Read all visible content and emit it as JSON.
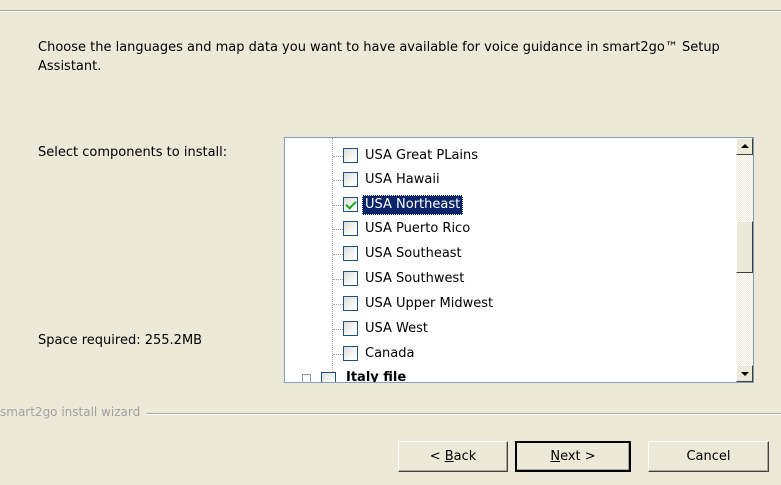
{
  "header": {
    "description": "Choose the languages and map data you want to have available for voice guidance in smart2go™ Setup Assistant."
  },
  "labels": {
    "select_components": "Select components to install:",
    "space_required": "Space required: 255.2MB"
  },
  "tree": {
    "items": [
      {
        "label": "USA Great PLains",
        "checked": false,
        "selected": false
      },
      {
        "label": "USA Hawaii",
        "checked": false,
        "selected": false
      },
      {
        "label": "USA Northeast",
        "checked": true,
        "selected": true
      },
      {
        "label": "USA Puerto Rico",
        "checked": false,
        "selected": false
      },
      {
        "label": "USA Southeast",
        "checked": false,
        "selected": false
      },
      {
        "label": "USA Southwest",
        "checked": false,
        "selected": false
      },
      {
        "label": "USA Upper Midwest",
        "checked": false,
        "selected": false
      },
      {
        "label": "USA West",
        "checked": false,
        "selected": false
      },
      {
        "label": "Canada",
        "checked": false,
        "selected": false
      }
    ],
    "cut_off_item": "Italy file"
  },
  "footer": {
    "group_label": "smart2go install wizard"
  },
  "buttons": {
    "back_prefix": "< ",
    "back_mnemonic": "B",
    "back_rest": "ack",
    "next_mnemonic": "N",
    "next_rest": "ext >",
    "cancel": "Cancel"
  },
  "colors": {
    "dialog_bg": "#ece9d8",
    "selection_bg": "#0a246a",
    "check_mark": "#21a121",
    "disabled_text": "#a0a0a0"
  }
}
